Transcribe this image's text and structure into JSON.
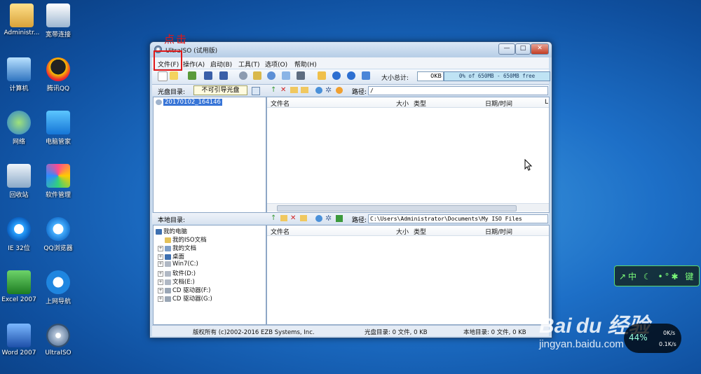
{
  "desktop": {
    "icons": [
      {
        "label": "Administr..."
      },
      {
        "label": "宽带连接"
      },
      {
        "label": "计算机"
      },
      {
        "label": "腾讯QQ"
      },
      {
        "label": "网络"
      },
      {
        "label": "电脑管家"
      },
      {
        "label": "回收站"
      },
      {
        "label": "软件管理"
      },
      {
        "label": "IE 32位"
      },
      {
        "label": "QQ浏览器"
      },
      {
        "label": "Excel 2007"
      },
      {
        "label": "上网导航"
      },
      {
        "label": "Word 2007"
      },
      {
        "label": "UltraISO"
      }
    ]
  },
  "annotation": {
    "text": "点击"
  },
  "window": {
    "title": "UltraISO (试用版)",
    "controls": {
      "minimize": "—",
      "maximize": "□",
      "close": "✕"
    },
    "menu": [
      "文件(F)",
      "操作(A)",
      "启动(B)",
      "工具(T)",
      "选项(O)",
      "帮助(H)"
    ],
    "toolbar": {
      "size_label": "大小总计:",
      "size_value": "0KB",
      "capacity": "0% of 650MB - 650MB free"
    },
    "cd_pane": {
      "label": "光盘目录:",
      "boot_button": "不可引导光盘",
      "path_label": "路径:",
      "path": "/",
      "root_item": "20170102_164146"
    },
    "local_pane": {
      "label": "本地目录:",
      "path_label": "路径:",
      "path": "C:\\Users\\Administrator\\Documents\\My ISO Files"
    },
    "columns": {
      "name": "文件名",
      "size": "大小",
      "type": "类型",
      "date": "日期/时间",
      "extra": "L"
    },
    "tree": [
      "我的电脑",
      "我的ISO文档",
      "我的文档",
      "桌面",
      "Win7(C:)",
      "软件(D:)",
      "文档(E:)",
      "CD 驱动器(F:)",
      "CD 驱动器(G:)"
    ],
    "status": {
      "copyright": "版权所有 (c)2002-2016 EZB Systems, Inc.",
      "cd": "光盘目录: 0 文件, 0 KB",
      "local": "本地目录: 0 文件, 0 KB"
    }
  },
  "overlays": {
    "widget_text": "↗中 ☾ •°✱ 键",
    "watermark_logo": "Bai du 经验",
    "watermark_url": "jingyan.baidu.com",
    "net_percent": "44%",
    "net_up": "0K/s",
    "net_down": "0.1K/s"
  },
  "colors": {
    "highlight": "#e01818",
    "capacity_bar": "#bfe3f4"
  }
}
